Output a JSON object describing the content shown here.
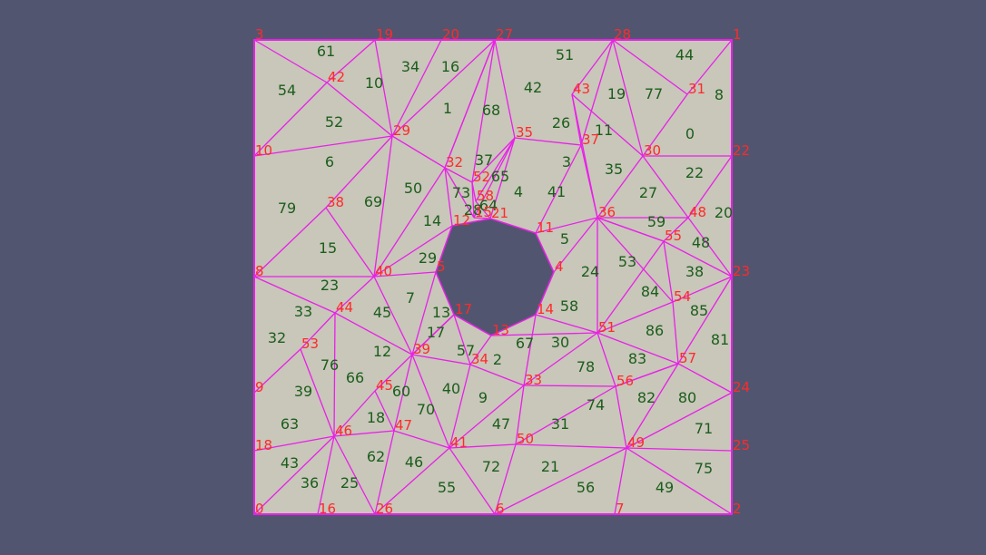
{
  "colors": {
    "background": "#525570",
    "domain_fill": "#c9c6ba",
    "edge": "#e820e8",
    "node_label": "#ff2a2a",
    "element_label": "#1b5e1b"
  },
  "node_labels": [
    "0",
    "1",
    "2",
    "3",
    "4",
    "5",
    "6",
    "7",
    "8",
    "9",
    "10",
    "11",
    "12",
    "13",
    "14",
    "15",
    "16",
    "17",
    "18",
    "19",
    "20",
    "21",
    "22",
    "23",
    "24",
    "25",
    "26",
    "27",
    "28",
    "29",
    "30",
    "31",
    "32",
    "33",
    "34",
    "35",
    "36",
    "37",
    "38",
    "39",
    "40",
    "41",
    "42",
    "43",
    "44",
    "45",
    "46",
    "47",
    "48",
    "49",
    "50",
    "51",
    "52",
    "53",
    "54",
    "55",
    "56",
    "57",
    "58"
  ],
  "element_labels": [
    "0",
    "1",
    "2",
    "3",
    "4",
    "5",
    "6",
    "7",
    "8",
    "9",
    "10",
    "11",
    "12",
    "13",
    "14",
    "15",
    "16",
    "17",
    "18",
    "19",
    "20",
    "21",
    "22",
    "23",
    "24",
    "25",
    "26",
    "27",
    "28",
    "29",
    "30",
    "31",
    "32",
    "33",
    "34",
    "35",
    "36",
    "37",
    "38",
    "39",
    "40",
    "41",
    "42",
    "43",
    "44",
    "45",
    "46",
    "47",
    "48",
    "49",
    "50",
    "51",
    "52",
    "53",
    "54",
    "55",
    "56",
    "57",
    "58",
    "59",
    "60",
    "61",
    "62",
    "63",
    "64",
    "65",
    "66",
    "67",
    "68",
    "69",
    "70",
    "71",
    "72",
    "73",
    "74",
    "75",
    "76",
    "77",
    "78",
    "79",
    "80",
    "81",
    "82",
    "83",
    "84",
    "85",
    "86"
  ]
}
